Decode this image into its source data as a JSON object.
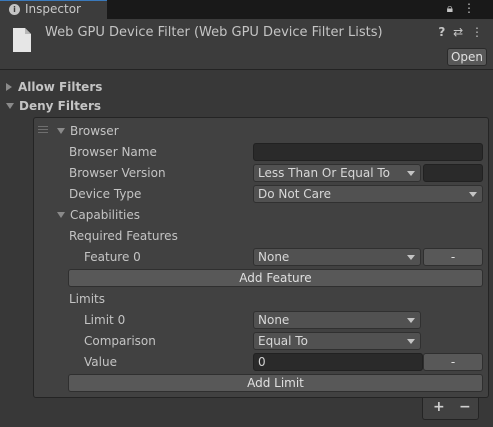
{
  "tab": {
    "label": "Inspector",
    "icon": "info-icon"
  },
  "window_icons": {
    "lock": "🔒",
    "menu": "⋮"
  },
  "header": {
    "title": "Web GPU Device Filter (Web GPU Device Filter Lists)",
    "help_icon": "?",
    "presets_icon": "⇄",
    "more_icon": "⋮",
    "open_label": "Open"
  },
  "foldouts": {
    "allow": "Allow Filters",
    "deny": "Deny Filters"
  },
  "browser": {
    "title": "Browser",
    "name_label": "Browser Name",
    "name_value": "",
    "version_label": "Browser Version",
    "version_comparison": "Less Than Or Equal To",
    "version_value": "",
    "device_type_label": "Device Type",
    "device_type_value": "Do Not Care"
  },
  "capabilities": {
    "title": "Capabilities",
    "required_features_label": "Required Features",
    "feature0_label": "Feature 0",
    "feature0_value": "None",
    "remove_label": "-",
    "add_feature_label": "Add Feature",
    "limits_label": "Limits",
    "limit0_label": "Limit 0",
    "limit0_value": "None",
    "comparison_label": "Comparison",
    "comparison_value": "Equal To",
    "value_label": "Value",
    "value_value": "0",
    "add_limit_label": "Add Limit"
  },
  "list_controls": {
    "add": "+",
    "remove": "−"
  }
}
